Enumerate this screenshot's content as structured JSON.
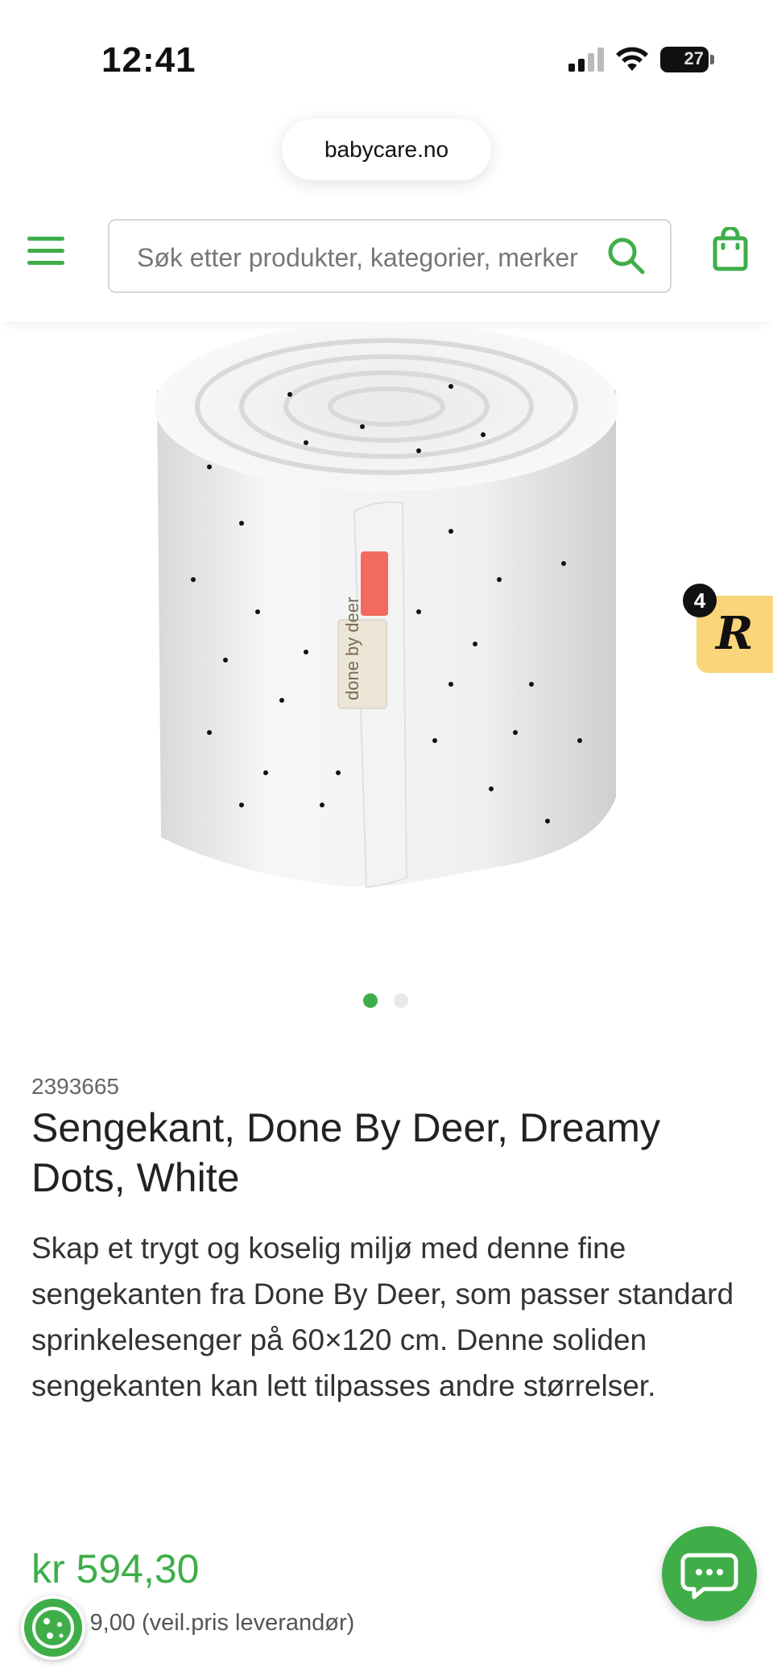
{
  "status_bar": {
    "time": "12:41",
    "battery": "27",
    "icons": [
      "cellular-signal-icon",
      "wifi-icon",
      "battery-icon"
    ]
  },
  "browser": {
    "url": "babycare.no"
  },
  "header": {
    "menu_icon": "hamburger-menu-icon",
    "search_placeholder": "Søk etter produkter, kategorier, merker",
    "search_icon": "search-icon",
    "cart_icon": "shopping-bag-icon",
    "accent_color": "#3fae49"
  },
  "product": {
    "image_alt": "Rolled white bed bumper with black dots and done by deer label",
    "label_text": "done by deer",
    "gallery": {
      "count": 2,
      "active_index": 0
    },
    "sku": "2393665",
    "title": "Sengekant, Done By Deer, Dreamy Dots, White",
    "description": "Skap et trygt og koselig miljø med denne fine sengekanten fra Done By Deer, som passer standard sprinkelesenger på 60×120 cm. Denne soliden sengekanten kan lett tilpasses andre størrelser.",
    "price": "kr 594,30",
    "old_price_visible": "9,00 (veil.pris leverandør)"
  },
  "widgets": {
    "review_badge_count": "4",
    "review_badge_letter": "R",
    "review_badge_color": "#fbd57a",
    "chat_icon": "chat-bubble-icon",
    "cookie_icon": "cookie-icon"
  }
}
